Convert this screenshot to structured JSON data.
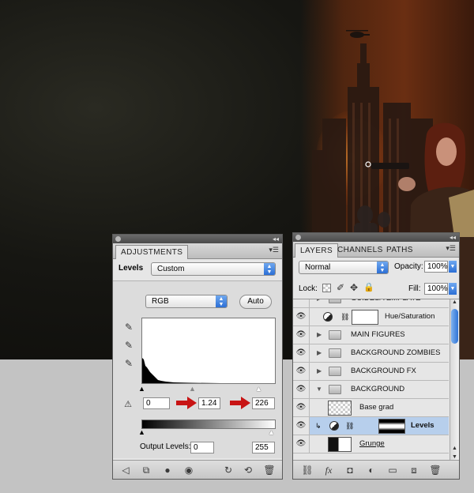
{
  "adjustments": {
    "tab": "ADJUSTMENTS",
    "preset_label": "Levels",
    "preset_value": "Custom",
    "channel_value": "RGB",
    "auto_label": "Auto",
    "input_black": "0",
    "input_gamma": "1.24",
    "input_white": "226",
    "output_label": "Output Levels:",
    "output_black": "0",
    "output_white": "255",
    "accent": "#2c6fd5",
    "arrow_color": "#c81414"
  },
  "layers": {
    "tabs": [
      "LAYERS",
      "CHANNELS",
      "PATHS"
    ],
    "blend_mode": "Normal",
    "opacity_label": "Opacity:",
    "opacity_value": "100%",
    "lock_label": "Lock:",
    "fill_label": "Fill:",
    "fill_value": "100%",
    "rows": [
      {
        "name": "GUIDES/TEMPLATE",
        "kind": "group"
      },
      {
        "name": "Hue/Saturation",
        "kind": "adjustment"
      },
      {
        "name": "MAIN FIGURES",
        "kind": "group"
      },
      {
        "name": "BACKGROUND ZOMBIES",
        "kind": "group"
      },
      {
        "name": "BACKGROUND FX",
        "kind": "group"
      },
      {
        "name": "BACKGROUND",
        "kind": "group-open"
      },
      {
        "name": "Base grad",
        "kind": "layer"
      },
      {
        "name": "Levels",
        "kind": "adjustment-selected"
      },
      {
        "name": "Grunge",
        "kind": "layer"
      }
    ]
  },
  "icons": [
    "eyedropper-black-icon",
    "eyedropper-gray-icon",
    "eyedropper-white-icon",
    "clipping-warning-icon",
    "eye-icon",
    "folder-icon",
    "chain-link-icon",
    "lock-icon",
    "brush-icon",
    "move-icon",
    "trash-icon",
    "panel-menu-icon"
  ]
}
